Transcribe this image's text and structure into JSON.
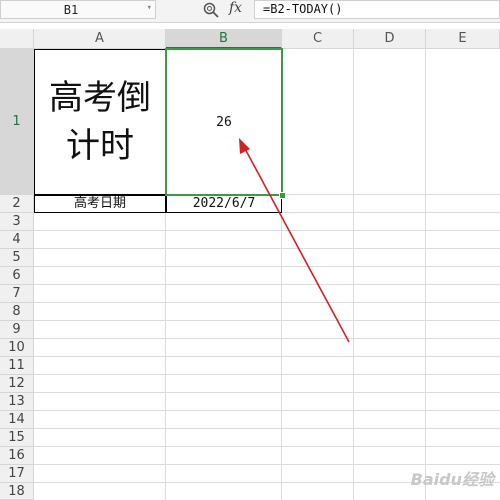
{
  "formula_bar": {
    "name_box": "B1",
    "formula": "=B2-TODAY()",
    "fx_label": "fx",
    "zoom_icon": "zoom-icon",
    "dropdown_icon": "chevron-down-icon"
  },
  "columns": [
    "A",
    "B",
    "C",
    "D",
    "E"
  ],
  "rows": [
    "1",
    "2",
    "3",
    "4",
    "5",
    "6",
    "7",
    "8",
    "9",
    "10",
    "11",
    "12",
    "13",
    "14",
    "15",
    "16",
    "17",
    "18"
  ],
  "cells": {
    "A1": "高考倒计时",
    "B1": "26",
    "A2": "高考日期",
    "B2": "2022/6/7"
  },
  "selected": {
    "cell": "B1",
    "column": "B",
    "row": "1"
  },
  "colors": {
    "selection": "#3a9a4a",
    "arrow": "#d42020"
  },
  "watermark": "Baidu经验"
}
